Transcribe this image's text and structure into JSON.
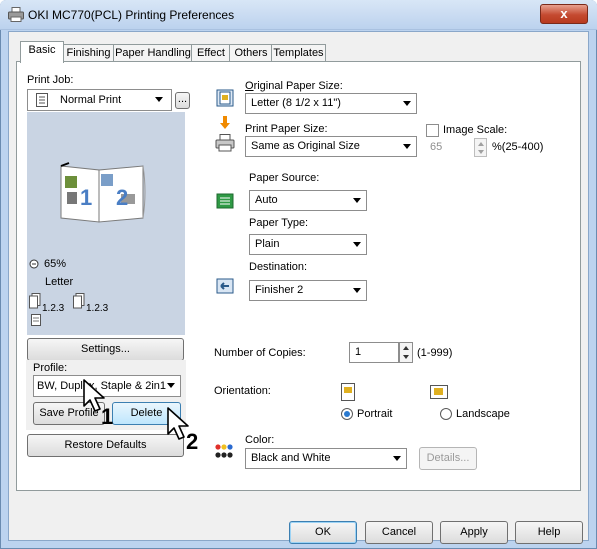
{
  "window": {
    "title": "OKI MC770(PCL) Printing Preferences",
    "close_glyph": "x"
  },
  "tabs": [
    {
      "label": "Basic",
      "active": true
    },
    {
      "label": "Finishing"
    },
    {
      "label": "Paper Handling"
    },
    {
      "label": "Effect"
    },
    {
      "label": "Others"
    },
    {
      "label": "Templates"
    }
  ],
  "print_job": {
    "label": "Print Job:",
    "value": "Normal Print",
    "more": "..."
  },
  "preview": {
    "zoom": "65%",
    "paper": "Letter",
    "stack_a": "1.2.3",
    "stack_b": "1.2.3",
    "page1": "1",
    "page2": "2"
  },
  "settings_button": "Settings...",
  "profile": {
    "label": "Profile:",
    "value": "BW, Duplex, Staple & 2in1",
    "save": "Save Profile",
    "delete": "Delete"
  },
  "restore_button": "Restore Defaults",
  "callouts": {
    "one": "1",
    "two": "2"
  },
  "original_size": {
    "label": "Original Paper Size:",
    "value": "Letter (8 1/2 x 11\")"
  },
  "print_size": {
    "label": "Print Paper Size:",
    "value": "Same as Original Size"
  },
  "image_scale": {
    "label": "Image Scale:",
    "value": "65",
    "range": "%(25-400)"
  },
  "paper_source": {
    "label": "Paper Source:",
    "value": "Auto"
  },
  "paper_type": {
    "label": "Paper Type:",
    "value": "Plain"
  },
  "destination": {
    "label": "Destination:",
    "value": "Finisher 2"
  },
  "copies": {
    "label": "Number of Copies:",
    "value": "1",
    "range": "(1-999)"
  },
  "orientation": {
    "label": "Orientation:",
    "portrait": "Portrait",
    "landscape": "Landscape",
    "selected": "portrait"
  },
  "color": {
    "label": "Color:",
    "value": "Black and White",
    "details": "Details..."
  },
  "footer": {
    "ok": "OK",
    "cancel": "Cancel",
    "apply": "Apply",
    "help": "Help"
  }
}
